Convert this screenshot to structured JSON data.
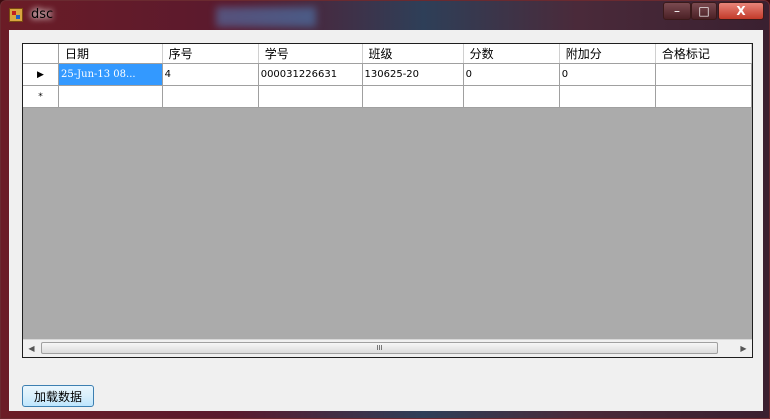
{
  "window": {
    "title": "dsc"
  },
  "controls": {
    "minimize": "–",
    "maximize": "□",
    "close": "X"
  },
  "grid": {
    "columns": [
      "日期",
      "序号",
      "学号",
      "班级",
      "分数",
      "附加分",
      "合格标记"
    ],
    "rows": [
      [
        "25-Jun-13 08...",
        "4",
        "000031226631",
        "130625-20",
        "0",
        "0",
        ""
      ]
    ],
    "current_row_marker": "▶",
    "new_row_marker": "*",
    "scroll": {
      "left": "◀",
      "right": "▶",
      "grip": "III"
    }
  },
  "button": {
    "load_label": "加载数据"
  }
}
